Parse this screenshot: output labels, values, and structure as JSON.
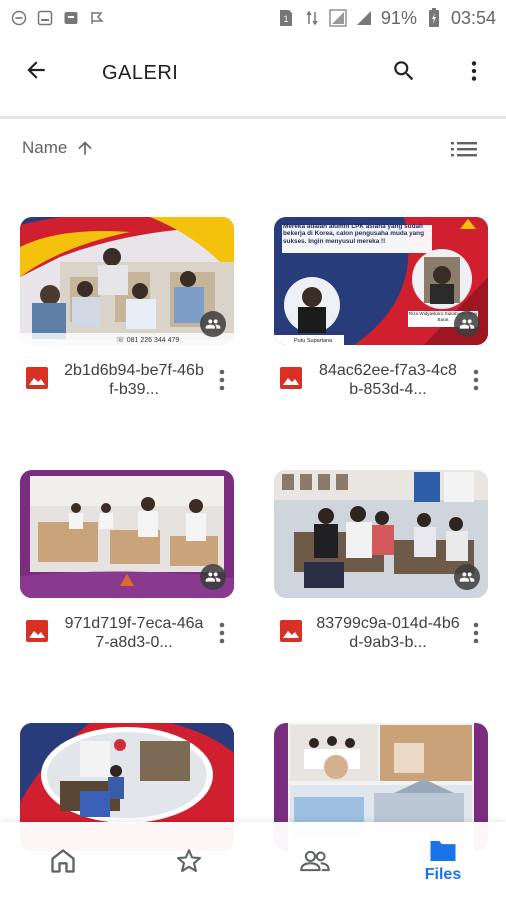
{
  "status_bar": {
    "battery_percent": "91%",
    "time": "03:54",
    "left_icons": [
      "minus-circle-icon",
      "image-icon",
      "archive-icon",
      "flag-icon"
    ],
    "right_icons": [
      "sim-icon",
      "data-arrows-icon",
      "signal-icon",
      "signal-icon",
      "battery-icon"
    ]
  },
  "app_bar": {
    "title": "GALERI",
    "back_icon": "arrow-left-icon",
    "search_icon": "search-icon",
    "more_icon": "more-vert-icon"
  },
  "sort": {
    "label": "Name",
    "direction_icon": "arrow-up-icon",
    "view_toggle_icon": "list-view-icon"
  },
  "files": [
    {
      "name": "2b1d6b94-be7f-46bf-b39...",
      "type_icon": "image-icon",
      "shared": true
    },
    {
      "name": "84ac62ee-f7a3-4c8b-853d-4...",
      "type_icon": "image-icon",
      "shared": true
    },
    {
      "name": "971d719f-7eca-46a7-a8d3-0...",
      "type_icon": "image-icon",
      "shared": true
    },
    {
      "name": "83799c9a-014d-4b6d-9ab3-b...",
      "type_icon": "image-icon",
      "shared": true
    },
    {
      "name": "",
      "type_icon": "image-icon",
      "shared": false
    },
    {
      "name": "",
      "type_icon": "image-icon",
      "shared": false
    }
  ],
  "thumb_text": {
    "card1_caption": "☏ 081 226 344 479",
    "card2_headline": "Mereka adalah alumni LPK asiana yang sudah bekerja di Korea, calon pengusaha muda yang sukses. Ingin menyusul mereka !!",
    "card2_caption_left": "Putu Supartana",
    "card2_caption_right": "Riza Widyaskoro Sukabumi Jawa Barat"
  },
  "bottom_nav": {
    "items": [
      {
        "name": "home",
        "icon": "home-icon",
        "label": ""
      },
      {
        "name": "starred",
        "icon": "star-icon",
        "label": ""
      },
      {
        "name": "shared",
        "icon": "people-icon",
        "label": ""
      },
      {
        "name": "files",
        "icon": "folder-icon",
        "label": "Files",
        "active": true
      }
    ]
  },
  "colors": {
    "accent": "#1a73e8",
    "image_icon_red": "#d93025",
    "brand_navy": "#283b7a",
    "brand_red": "#d0202f",
    "brand_yellow": "#f4c20d",
    "brand_purple": "#7a2d7e"
  }
}
